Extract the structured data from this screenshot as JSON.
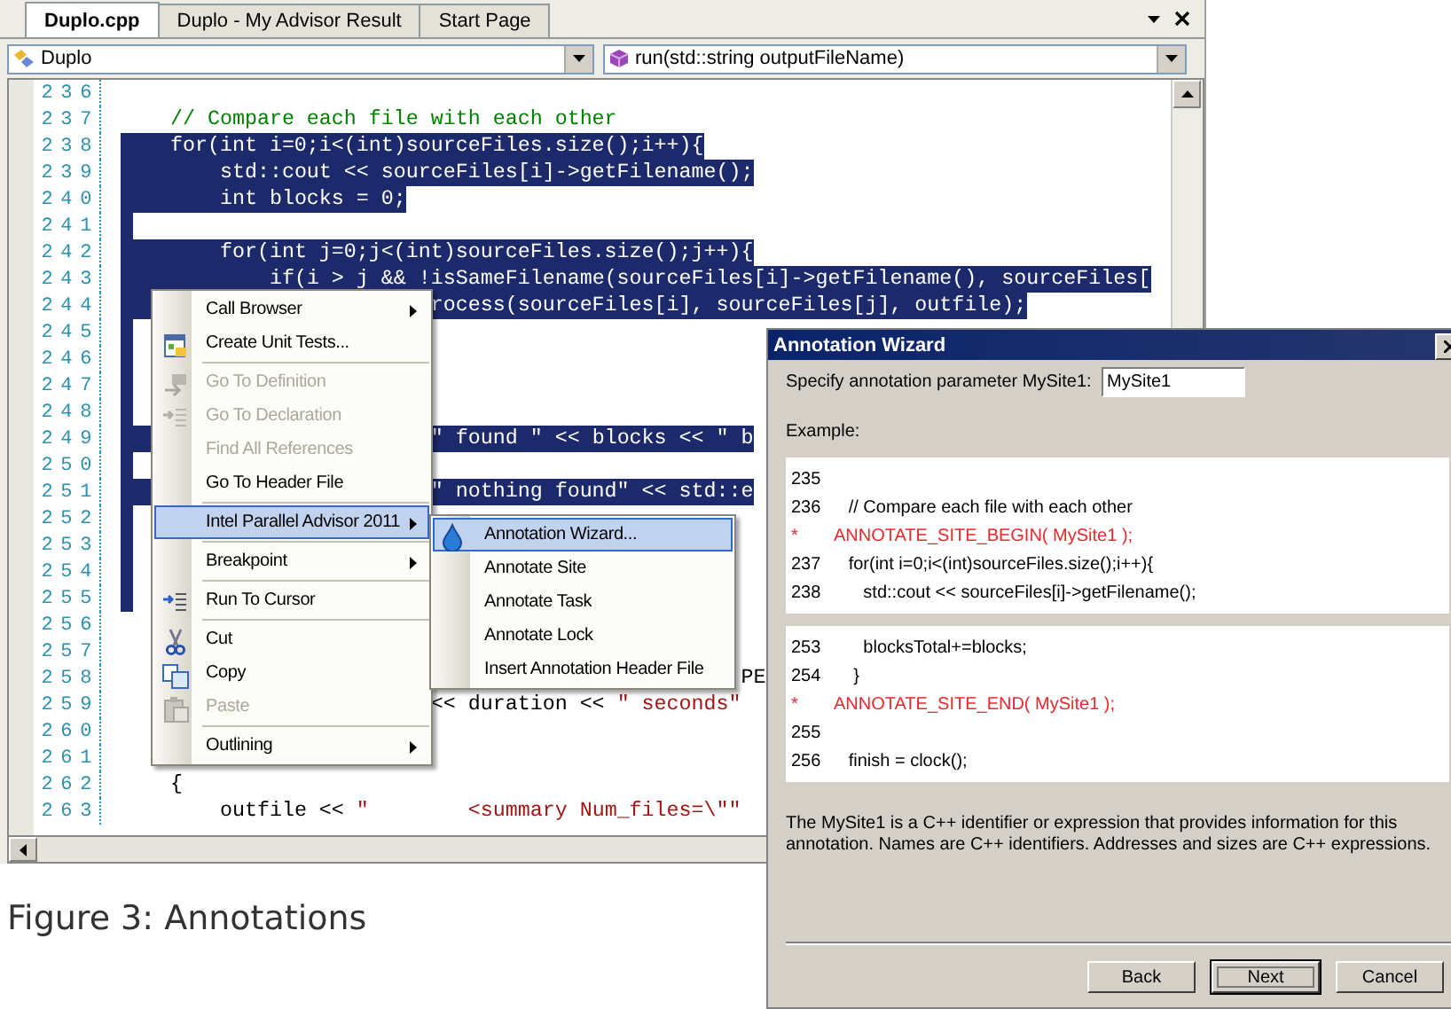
{
  "editor": {
    "tabs": [
      {
        "label": "Duplo.cpp",
        "selected": true
      },
      {
        "label": "Duplo - My Advisor Result",
        "selected": false
      },
      {
        "label": "Start Page",
        "selected": false
      }
    ],
    "type_dropdown": {
      "value": "Duplo"
    },
    "member_dropdown": {
      "value": "run(std::string outputFileName)"
    },
    "lines": [
      {
        "number": "236",
        "selected": false
      },
      {
        "number": "237",
        "selected": false,
        "segments": [
          {
            "kind": "comment",
            "text": "    // Compare each file with each other"
          }
        ]
      },
      {
        "number": "238",
        "selected": true,
        "segments": [
          {
            "kind": "code",
            "text": "    for(int i=0;i<(int)sourceFiles.size();i++){"
          }
        ]
      },
      {
        "number": "239",
        "selected": true,
        "segments": [
          {
            "kind": "code",
            "text": "        std::cout << sourceFiles[i]->getFilename();"
          }
        ]
      },
      {
        "number": "240",
        "selected": true,
        "segments": [
          {
            "kind": "code",
            "text": "        int blocks = 0;"
          }
        ]
      },
      {
        "number": "241",
        "selected": true
      },
      {
        "number": "242",
        "selected": true,
        "segments": [
          {
            "kind": "code",
            "text": "        for(int j=0;j<(int)sourceFiles.size();j++){"
          }
        ]
      },
      {
        "number": "243",
        "selected": true,
        "segments": [
          {
            "kind": "code",
            "text": "            if(i > j && !isSameFilename(sourceFiles[i]->getFilename(), sourceFiles["
          }
        ]
      },
      {
        "number": "244",
        "selected": true,
        "segments": [
          {
            "kind": "code",
            "text": "                         rocess(sourceFiles[i], sourceFiles[j], outfile);"
          }
        ]
      },
      {
        "number": "245",
        "selected": true
      },
      {
        "number": "246",
        "selected": true
      },
      {
        "number": "247",
        "selected": true
      },
      {
        "number": "248",
        "selected": true
      },
      {
        "number": "249",
        "selected": true,
        "segments": [
          {
            "kind": "string",
            "text": "                         \" found \""
          },
          {
            "kind": "code",
            "text": " << blocks << "
          },
          {
            "kind": "string",
            "text": "\" b"
          }
        ]
      },
      {
        "number": "250",
        "selected": true
      },
      {
        "number": "251",
        "selected": true,
        "segments": [
          {
            "kind": "string",
            "text": "                         \" nothing found\""
          },
          {
            "kind": "code",
            "text": " << std::e"
          }
        ]
      },
      {
        "number": "252",
        "selected": true
      },
      {
        "number": "253",
        "selected": true
      },
      {
        "number": "254",
        "selected": true
      },
      {
        "number": "255",
        "selected": true
      },
      {
        "number": "256",
        "selected": false
      },
      {
        "number": "257",
        "selected": false
      },
      {
        "number": "258",
        "selected": false,
        "segments": [
          {
            "kind": "code",
            "text": "                                                  PE"
          }
        ]
      },
      {
        "number": "259",
        "selected": false,
        "segments": [
          {
            "kind": "code",
            "text": "                         << duration << "
          },
          {
            "kind": "string",
            "text": "\" seconds\""
          }
        ]
      },
      {
        "number": "260",
        "selected": false
      },
      {
        "number": "261",
        "selected": false
      },
      {
        "number": "262",
        "selected": false,
        "segments": [
          {
            "kind": "code",
            "text": "    {"
          }
        ]
      },
      {
        "number": "263",
        "selected": false,
        "segments": [
          {
            "kind": "code",
            "text": "        outfile << "
          },
          {
            "kind": "string",
            "text": "\"        <summary Num_files=\\\"\""
          }
        ]
      }
    ]
  },
  "context_menu": {
    "groups": [
      [
        {
          "label": "Call Browser",
          "disabled": false,
          "selected": false,
          "submenu": true
        },
        {
          "label": "Create Unit Tests...",
          "disabled": false,
          "selected": false,
          "submenu": false
        }
      ],
      [
        {
          "label": "Go To Definition",
          "disabled": true,
          "selected": false,
          "submenu": false
        },
        {
          "label": "Go To Declaration",
          "disabled": true,
          "selected": false,
          "submenu": false
        },
        {
          "label": "Find All References",
          "disabled": true,
          "selected": false,
          "submenu": false
        },
        {
          "label": "Go To Header File",
          "disabled": false,
          "selected": false,
          "submenu": false
        }
      ],
      [
        {
          "label": "Intel Parallel Advisor 2011",
          "disabled": false,
          "selected": true,
          "submenu": true
        }
      ],
      [
        {
          "label": "Breakpoint",
          "disabled": false,
          "selected": false,
          "submenu": true
        }
      ],
      [
        {
          "label": "Run To Cursor",
          "disabled": false,
          "selected": false,
          "submenu": false
        }
      ],
      [
        {
          "label": "Cut",
          "disabled": false,
          "selected": false,
          "submenu": false
        },
        {
          "label": "Copy",
          "disabled": false,
          "selected": false,
          "submenu": false
        },
        {
          "label": "Paste",
          "disabled": true,
          "selected": false,
          "submenu": false
        }
      ],
      [
        {
          "label": "Outlining",
          "disabled": false,
          "selected": false,
          "submenu": true
        }
      ]
    ]
  },
  "submenu": {
    "items": [
      {
        "label": "Annotation Wizard...",
        "selected": true
      },
      {
        "label": "Annotate Site",
        "selected": false
      },
      {
        "label": "Annotate Task",
        "selected": false
      },
      {
        "label": "Annotate Lock",
        "selected": false
      },
      {
        "label": "Insert Annotation Header File",
        "selected": false
      }
    ]
  },
  "annotation_wizard": {
    "title": "Annotation Wizard",
    "prompt": "Specify annotation parameter MySite1:",
    "parameter_field": {
      "value": "MySite1"
    },
    "example_label": "Example:",
    "example_blocks": [
      [
        {
          "number": "235",
          "kind": "code"
        },
        {
          "number": "236",
          "kind": "code",
          "text": "   // Compare each file with each other"
        },
        {
          "number": "*",
          "kind": "annotation",
          "text": "ANNOTATE_SITE_BEGIN( MySite1 );"
        },
        {
          "number": "237",
          "kind": "code",
          "text": "   for(int i=0;i<(int)sourceFiles.size();i++){"
        },
        {
          "number": "238",
          "kind": "code",
          "text": "      std::cout << sourceFiles[i]->getFilename();"
        }
      ],
      [
        {
          "number": "253",
          "kind": "code",
          "text": "      blocksTotal+=blocks;"
        },
        {
          "number": "254",
          "kind": "code",
          "text": "    }"
        },
        {
          "number": "*",
          "kind": "annotation",
          "text": "ANNOTATE_SITE_END( MySite1 );"
        },
        {
          "number": "255",
          "kind": "code"
        },
        {
          "number": "256",
          "kind": "code",
          "text": "   finish = clock();"
        }
      ]
    ],
    "description": "The MySite1 is a C++ identifier or expression that provides information for this annotation. Names are C++ identifiers. Addresses and sizes are C++ expressions.",
    "buttons": [
      {
        "label": "Back",
        "focused": false
      },
      {
        "label": "Next",
        "focused": true
      },
      {
        "label": "Cancel",
        "focused": false
      }
    ]
  },
  "caption": "Figure 3: Annotations"
}
